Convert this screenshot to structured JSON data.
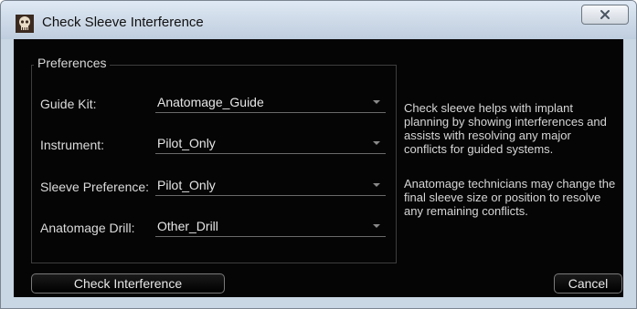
{
  "window": {
    "title": "Check Sleeve Interference",
    "close_label": "X"
  },
  "preferences": {
    "group_label": "Preferences",
    "rows": [
      {
        "label": "Guide Kit:",
        "value": "Anatomage_Guide"
      },
      {
        "label": "Instrument:",
        "value": "Pilot_Only"
      },
      {
        "label": "Sleeve Preference:",
        "value": "Pilot_Only"
      },
      {
        "label": "Anatomage Drill:",
        "value": "Other_Drill"
      }
    ]
  },
  "description": {
    "lines_1": [
      "Check sleeve helps with implant",
      "planning by showing interferences and",
      "assists with resolving any major",
      "conflicts for guided systems."
    ],
    "lines_2": [
      "Anatomage technicians may change the",
      "final sleeve size or position to resolve",
      "any remaining conflicts."
    ]
  },
  "buttons": {
    "check": "Check Interference",
    "cancel": "Cancel"
  },
  "colors": {
    "client_bg": "#050505",
    "frame": "#c9d6e4",
    "text": "#dcdcdc"
  },
  "icons": {
    "app": "skull-icon",
    "close": "close-icon",
    "dropdown": "chevron-down-icon"
  }
}
